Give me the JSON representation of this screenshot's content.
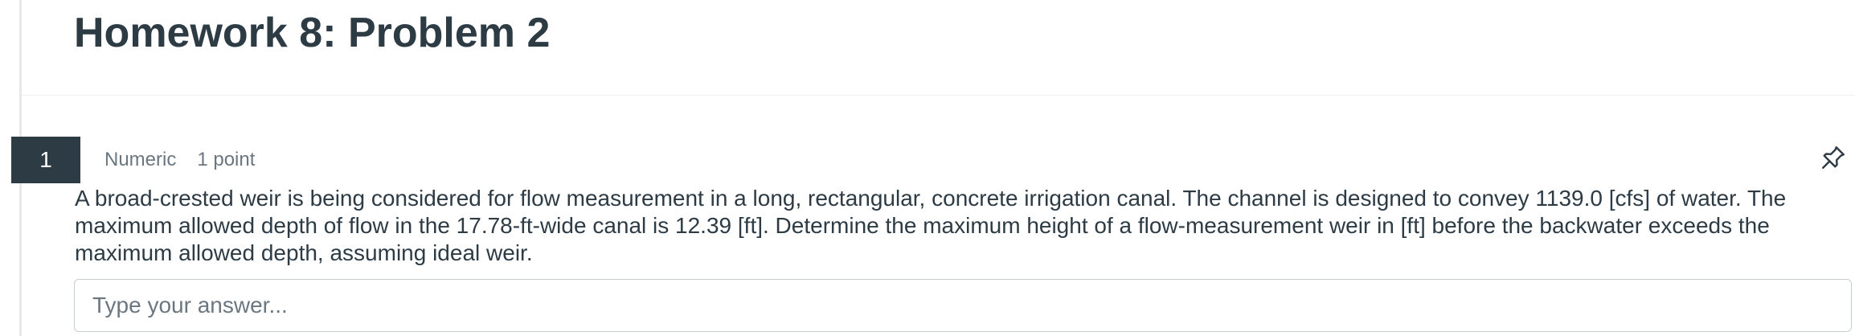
{
  "page": {
    "title": "Homework 8: Problem 2"
  },
  "question": {
    "number": "1",
    "type": "Numeric",
    "points": "1 point",
    "text": "A broad-crested weir is being considered for flow measurement in a long, rectangular, concrete irrigation canal. The channel is designed to convey 1139.0 [cfs] of water. The maximum allowed depth of flow in the 17.78-ft-wide canal is 12.39 [ft]. Determine the maximum height of a flow-measurement weir in [ft] before the backwater exceeds the maximum allowed depth, assuming ideal weir.",
    "pin_icon": "pin-icon",
    "answer": {
      "value": "",
      "placeholder": "Type your answer..."
    }
  },
  "colors": {
    "text": "#2d3b45",
    "muted": "#6b7780",
    "number_badge_bg": "#2d3b45",
    "border": "#c7cdd1"
  }
}
